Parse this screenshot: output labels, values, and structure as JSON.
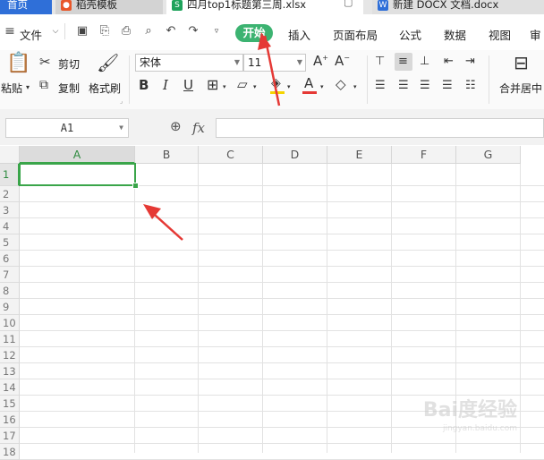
{
  "tabs": [
    {
      "label": "首页",
      "active": false
    },
    {
      "label": "稻壳模板",
      "active": false
    },
    {
      "label": "四月top1标题第三周.xlsx",
      "active": true
    },
    {
      "label": "新建 DOCX 文档.docx",
      "active": false
    }
  ],
  "menu": {
    "file": "文件",
    "start": "开始",
    "insert": "插入",
    "page_layout": "页面布局",
    "formula": "公式",
    "data": "数据",
    "view": "视图",
    "review": "审"
  },
  "ribbon": {
    "paste": "粘贴",
    "cut": "剪切",
    "copy": "复制",
    "format_painter": "格式刷",
    "font_name": "宋体",
    "font_size": "11",
    "bold": "B",
    "italic": "I",
    "underline": "U",
    "merge_center": "合并居中"
  },
  "formula_bar": {
    "cell_ref": "A1",
    "fx_label": "fx",
    "formula_value": ""
  },
  "grid": {
    "columns": [
      "A",
      "B",
      "C",
      "D",
      "E",
      "F",
      "G"
    ],
    "rows": [
      "1",
      "2",
      "3",
      "4",
      "5",
      "6",
      "7",
      "8",
      "9",
      "10",
      "11",
      "12",
      "13",
      "14",
      "15",
      "16",
      "17",
      "18"
    ],
    "active_cell": "A1"
  },
  "watermark": {
    "text": "Bai度经验",
    "sub": "jingyan.baidu.com"
  },
  "colors": {
    "accent_green": "#3cb371",
    "arrow_red": "#e53935",
    "tab_blue": "#2f6fd8"
  }
}
